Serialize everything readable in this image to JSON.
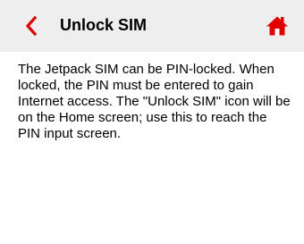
{
  "header": {
    "title": "Unlock SIM",
    "back_icon": "chevron-left-icon",
    "home_icon": "home-icon",
    "accent_color": "#e00000",
    "background_color": "#eeeeee"
  },
  "content": {
    "text": "The Jetpack SIM can be PIN-locked. When locked, the PIN must be entered to gain Internet access. The \"Unlock SIM\" icon will be on the Home screen; use this to reach the PIN input screen."
  }
}
